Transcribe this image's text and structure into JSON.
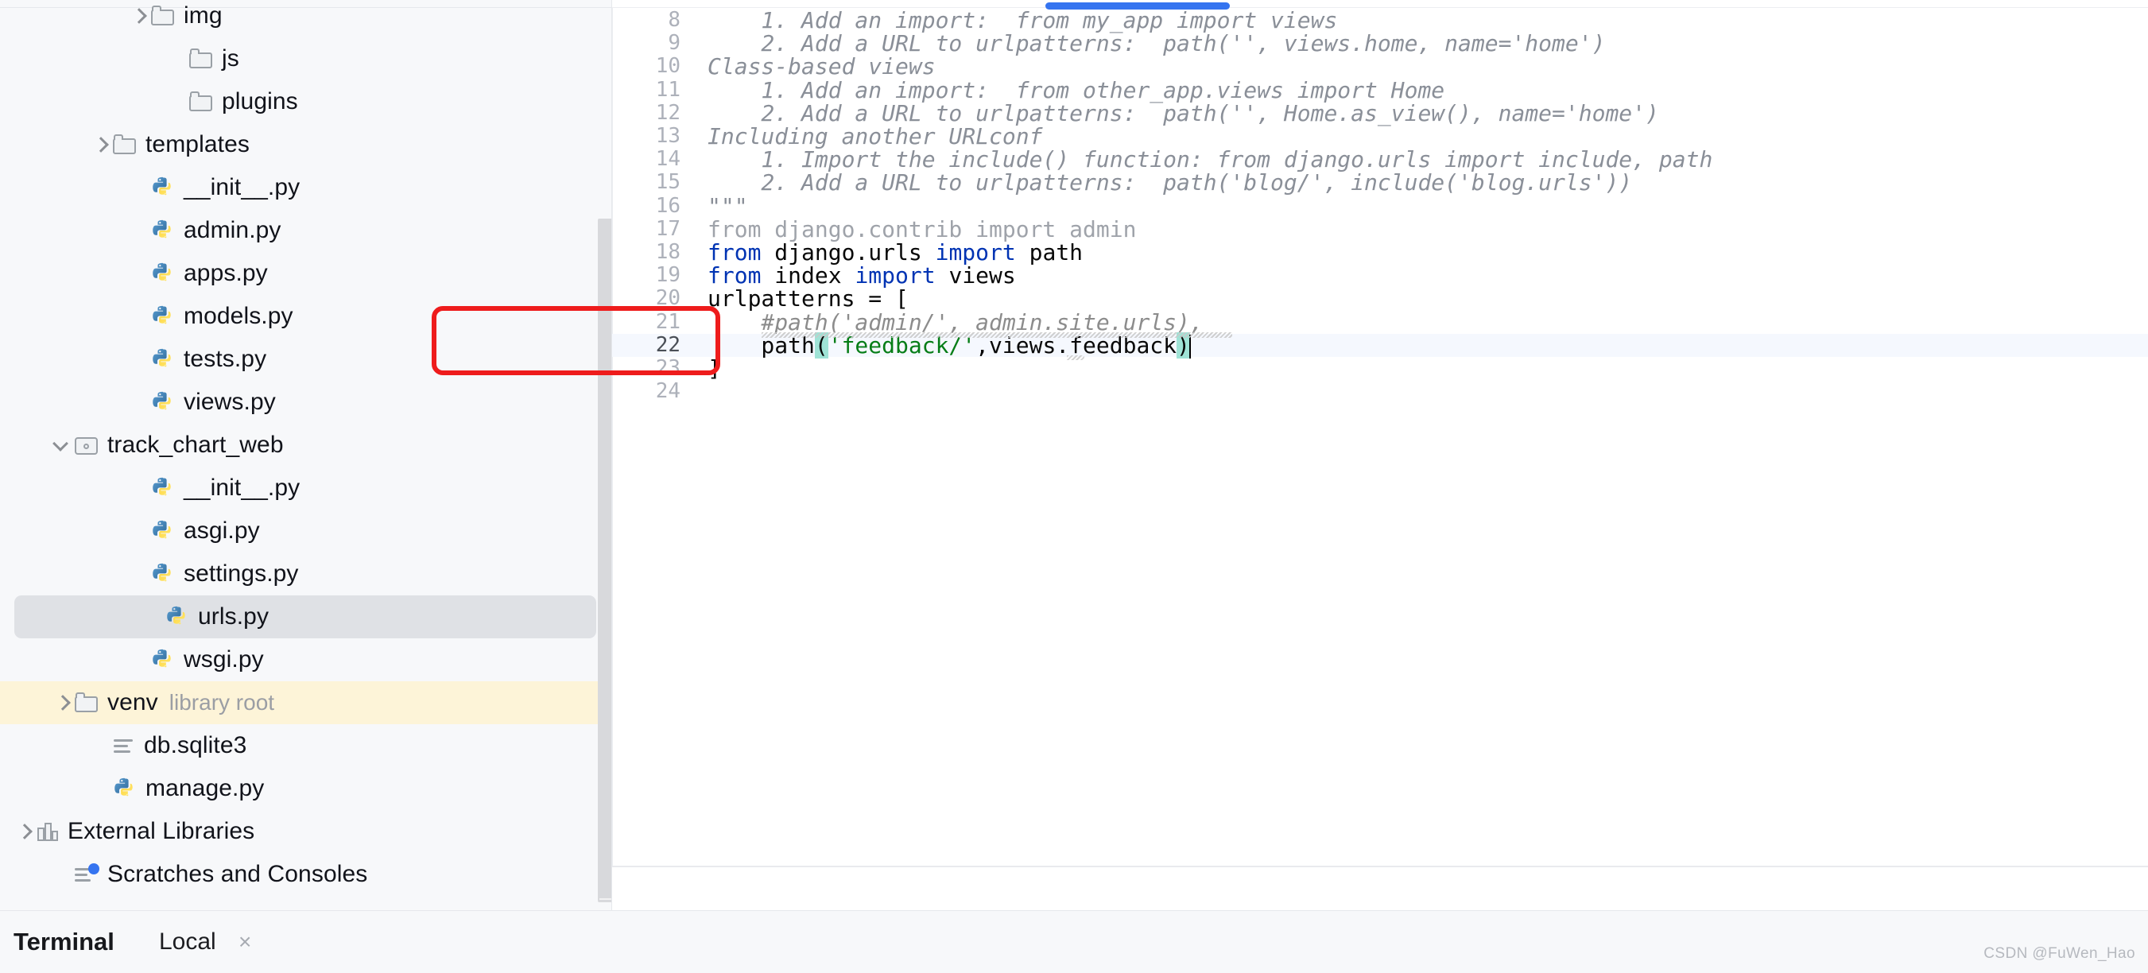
{
  "sidebar": {
    "scrollbar": "visible",
    "items": [
      {
        "label": "img",
        "kind": "folder",
        "indent": 3,
        "arrow": "closed",
        "state": "normal"
      },
      {
        "label": "js",
        "kind": "folder",
        "indent": 4,
        "arrow": "none",
        "state": "normal"
      },
      {
        "label": "plugins",
        "kind": "folder",
        "indent": 4,
        "arrow": "none",
        "state": "normal"
      },
      {
        "label": "templates",
        "kind": "folder",
        "indent": 2,
        "arrow": "closed",
        "state": "normal"
      },
      {
        "label": "__init__.py",
        "kind": "python",
        "indent": 3,
        "arrow": "none",
        "state": "normal"
      },
      {
        "label": "admin.py",
        "kind": "python",
        "indent": 3,
        "arrow": "none",
        "state": "normal"
      },
      {
        "label": "apps.py",
        "kind": "python",
        "indent": 3,
        "arrow": "none",
        "state": "normal"
      },
      {
        "label": "models.py",
        "kind": "python",
        "indent": 3,
        "arrow": "none",
        "state": "normal"
      },
      {
        "label": "tests.py",
        "kind": "python",
        "indent": 3,
        "arrow": "none",
        "state": "normal"
      },
      {
        "label": "views.py",
        "kind": "python",
        "indent": 3,
        "arrow": "none",
        "state": "normal"
      },
      {
        "label": "track_chart_web",
        "kind": "modfolder",
        "indent": 1,
        "arrow": "open",
        "state": "normal"
      },
      {
        "label": "__init__.py",
        "kind": "python",
        "indent": 3,
        "arrow": "none",
        "state": "normal"
      },
      {
        "label": "asgi.py",
        "kind": "python",
        "indent": 3,
        "arrow": "none",
        "state": "normal"
      },
      {
        "label": "settings.py",
        "kind": "python",
        "indent": 3,
        "arrow": "none",
        "state": "normal"
      },
      {
        "label": "urls.py",
        "kind": "python",
        "indent": 3,
        "arrow": "none",
        "state": "selected"
      },
      {
        "label": "wsgi.py",
        "kind": "python",
        "indent": 3,
        "arrow": "none",
        "state": "normal"
      },
      {
        "label": "venv",
        "sublabel": "library root",
        "kind": "folder",
        "indent": 1,
        "arrow": "closed",
        "state": "library-root"
      },
      {
        "label": "db.sqlite3",
        "kind": "db",
        "indent": 2,
        "arrow": "none",
        "state": "normal"
      },
      {
        "label": "manage.py",
        "kind": "python",
        "indent": 2,
        "arrow": "none",
        "state": "normal"
      },
      {
        "label": "External Libraries",
        "kind": "lib",
        "indent": 0,
        "arrow": "closed",
        "state": "normal"
      },
      {
        "label": "Scratches and Consoles",
        "kind": "scratches",
        "indent": 1,
        "arrow": "none",
        "state": "normal"
      }
    ]
  },
  "editor": {
    "file": "urls.py",
    "horizontal_scrollbar_color": "#3574f0",
    "current_line": 22,
    "lines": [
      {
        "n": "8",
        "segments": [
          {
            "t": "    1. Add an import:  from my_app import views",
            "c": "doc"
          }
        ]
      },
      {
        "n": "9",
        "segments": [
          {
            "t": "    2. Add a URL to urlpatterns:  path('', views.home, name='home')",
            "c": "doc"
          }
        ]
      },
      {
        "n": "10",
        "segments": [
          {
            "t": "Class-based views",
            "c": "doc"
          }
        ]
      },
      {
        "n": "11",
        "segments": [
          {
            "t": "    1. Add an import:  from other_app.views import Home",
            "c": "doc"
          }
        ]
      },
      {
        "n": "12",
        "segments": [
          {
            "t": "    2. Add a URL to urlpatterns:  path('', Home.as_view(), name='home')",
            "c": "doc"
          }
        ]
      },
      {
        "n": "13",
        "segments": [
          {
            "t": "Including another URLconf",
            "c": "doc"
          }
        ]
      },
      {
        "n": "14",
        "segments": [
          {
            "t": "    1. Import the include() function: from django.urls import include, path",
            "c": "doc"
          }
        ]
      },
      {
        "n": "15",
        "segments": [
          {
            "t": "    2. Add a URL to urlpatterns:  path('blog/', include('blog.urls'))",
            "c": "doc"
          }
        ]
      },
      {
        "n": "16",
        "segments": [
          {
            "t": "\"\"\"",
            "c": "doc"
          }
        ]
      },
      {
        "n": "17",
        "segments": [
          {
            "t": "from django.contrib import admin",
            "c": "dim"
          }
        ]
      },
      {
        "n": "18",
        "segments": [
          {
            "t": "from ",
            "c": "kw"
          },
          {
            "t": "django.urls ",
            "c": ""
          },
          {
            "t": "import ",
            "c": "kw"
          },
          {
            "t": "path",
            "c": ""
          }
        ]
      },
      {
        "n": "19",
        "segments": [
          {
            "t": "from ",
            "c": "kw"
          },
          {
            "t": "index ",
            "c": ""
          },
          {
            "t": "import ",
            "c": "kw"
          },
          {
            "t": "views",
            "c": ""
          }
        ]
      },
      {
        "n": "20",
        "segments": [
          {
            "t": "urlpatterns = [",
            "c": ""
          }
        ]
      },
      {
        "n": "21",
        "segments": [
          {
            "t": "    #path('admin/', admin.site.urls),",
            "c": "cmt"
          }
        ]
      },
      {
        "n": "22",
        "segments": [
          {
            "t": "    path",
            "c": ""
          },
          {
            "t": "(",
            "c": "brace-hl"
          },
          {
            "t": "'feedback/'",
            "c": "str"
          },
          {
            "t": ",views.feedback",
            "c": ""
          },
          {
            "t": ")",
            "c": "brace-hl"
          }
        ],
        "caret": true
      },
      {
        "n": "23",
        "segments": [
          {
            "t": "]",
            "c": ""
          }
        ]
      },
      {
        "n": "24",
        "segments": [
          {
            "t": "",
            "c": ""
          }
        ]
      }
    ],
    "annotation": {
      "shape": "rounded-rectangle",
      "color": "#ee1c1c",
      "covers_lines": "21-22"
    }
  },
  "bottombar": {
    "terminal_label": "Terminal",
    "local_tab": "Local",
    "close_glyph": "×"
  },
  "watermark": "CSDN @FuWen_Hao"
}
